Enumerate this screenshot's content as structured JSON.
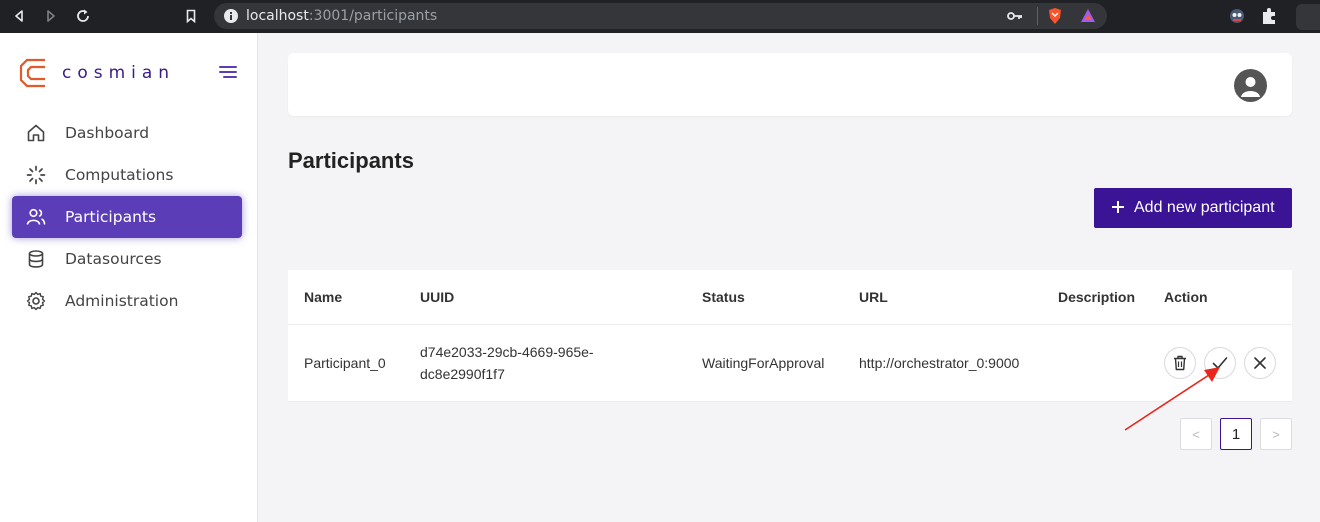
{
  "browser": {
    "url_host": "localhost",
    "url_path": ":3001/participants"
  },
  "brand": {
    "name": "cosmian",
    "accent_color": "#3b1495",
    "logo_color": "#e05a2a"
  },
  "sidebar": {
    "items": [
      {
        "label": "Dashboard",
        "icon": "home-icon",
        "active": false
      },
      {
        "label": "Computations",
        "icon": "spinner-icon",
        "active": false
      },
      {
        "label": "Participants",
        "icon": "users-icon",
        "active": true
      },
      {
        "label": "Datasources",
        "icon": "database-icon",
        "active": false
      },
      {
        "label": "Administration",
        "icon": "gear-icon",
        "active": false
      }
    ]
  },
  "main": {
    "title": "Participants",
    "add_button_label": "Add new participant"
  },
  "table": {
    "columns": [
      "Name",
      "UUID",
      "Status",
      "URL",
      "Description",
      "Action"
    ],
    "rows": [
      {
        "name": "Participant_0",
        "uuid_line1": "d74e2033-29cb-4669-965e-",
        "uuid_line2": "dc8e2990f1f7",
        "status": "WaitingForApproval",
        "url": "http://orchestrator_0:9000",
        "description": "",
        "actions": [
          "trash-icon",
          "check-icon",
          "close-icon"
        ]
      }
    ]
  },
  "pagination": {
    "prev": "<",
    "current": "1",
    "next": ">"
  }
}
